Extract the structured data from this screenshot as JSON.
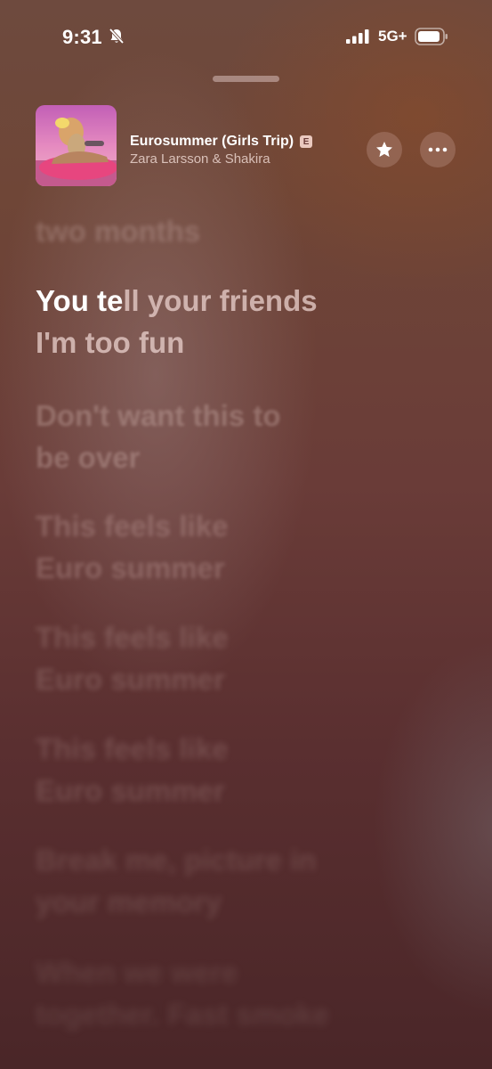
{
  "status_bar": {
    "time": "9:31",
    "network": "5G+",
    "icons": [
      "bell-muted-icon",
      "cellular-signal-icon",
      "battery-icon"
    ]
  },
  "now_playing": {
    "title": "Eurosummer (Girls Trip)",
    "explicit_badge": "E",
    "artist": "Zara Larsson & Shakira",
    "artwork": "album-cover",
    "actions": [
      "star-icon",
      "more-icon"
    ]
  },
  "lyrics": {
    "previous": "two months",
    "current_sung": "You te",
    "current_unsung": "ll your friends",
    "current_line2": "I'm too fun",
    "upcoming": [
      [
        "Don't want this to",
        "be over"
      ],
      [
        "This feels like",
        "Euro summer"
      ],
      [
        "This feels like",
        "Euro summer"
      ],
      [
        "This feels like",
        "Euro summer"
      ],
      [
        "Break me, picture in",
        "your memory"
      ],
      [
        "When we were",
        "together. Fast smoke"
      ]
    ]
  },
  "colors": {
    "background_top": "#6e4a3e",
    "background_bottom": "#4a2628",
    "active_lyric": "#ffffff"
  }
}
